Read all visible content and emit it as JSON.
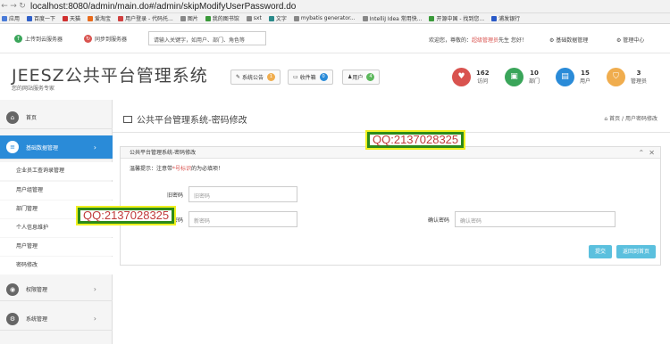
{
  "browser": {
    "url": "localhost:8080/admin/main.do#/admin/skipModifyUserPassword.do",
    "bookmarks": [
      "应用",
      "百度一下",
      "天猫",
      "爱淘宝",
      "用户登录 - 代码托...",
      "图片",
      "我的图书馆",
      "sxt",
      "文字",
      "mybatis generator...",
      "IntelliJ Idea 常用快...",
      "开源中国 - 找到您...",
      "浦发银行"
    ]
  },
  "topbar": {
    "upload_label": "上传到云服务器",
    "sync_label": "同步到服务器",
    "search_placeholder": "请输入关键字，如用户、部门、角色等",
    "welcome_prefix": "欢迎您，尊敬的：",
    "welcome_user": "超级管理员",
    "welcome_suffix": "先生 您好！",
    "base_data_menu": "基础数据管理",
    "admin_center_menu": "管理中心"
  },
  "header": {
    "brand": "JEESZ公共平台管理系统",
    "subtitle": "您的网站服务专家",
    "notice_label": "系统公告",
    "notice_count": "1",
    "inbox_label": "收件箱",
    "inbox_count": "0",
    "users_label": "用户",
    "users_count": "4",
    "stats": [
      {
        "num": "162",
        "label": "访问"
      },
      {
        "num": "10",
        "label": "部门"
      },
      {
        "num": "15",
        "label": "用户"
      },
      {
        "num": "3",
        "label": "管理员"
      }
    ]
  },
  "sidebar": {
    "home": "首页",
    "base_data": "基础数据管理",
    "sub_items": [
      "企业员工查询录管理",
      "用户组管理",
      "部门管理",
      "个人信息维护",
      "用户管理",
      "密码修改"
    ],
    "permissions": "权限管理",
    "system": "系统管理"
  },
  "main": {
    "page_title": "公共平台管理系统-密码修改",
    "breadcrumb_home": "首页",
    "breadcrumb_current": "用户密码修改",
    "panel_title": "公共平台管理系统-密码修改",
    "tip_prefix": "温馨提示：注意带",
    "tip_star": "*号标识",
    "tip_suffix": "的为必填项！",
    "old_pwd_label": "旧密码",
    "old_pwd_placeholder": "旧密码",
    "new_pwd_label": "新密码",
    "new_pwd_placeholder": "新密码",
    "confirm_pwd_label": "确认密码",
    "confirm_pwd_placeholder": "确认密码",
    "submit_label": "提交",
    "back_label": "返回到首页"
  },
  "watermark": {
    "text_top": "QQ:2137028325",
    "text_left": "QQ:2137028325"
  }
}
